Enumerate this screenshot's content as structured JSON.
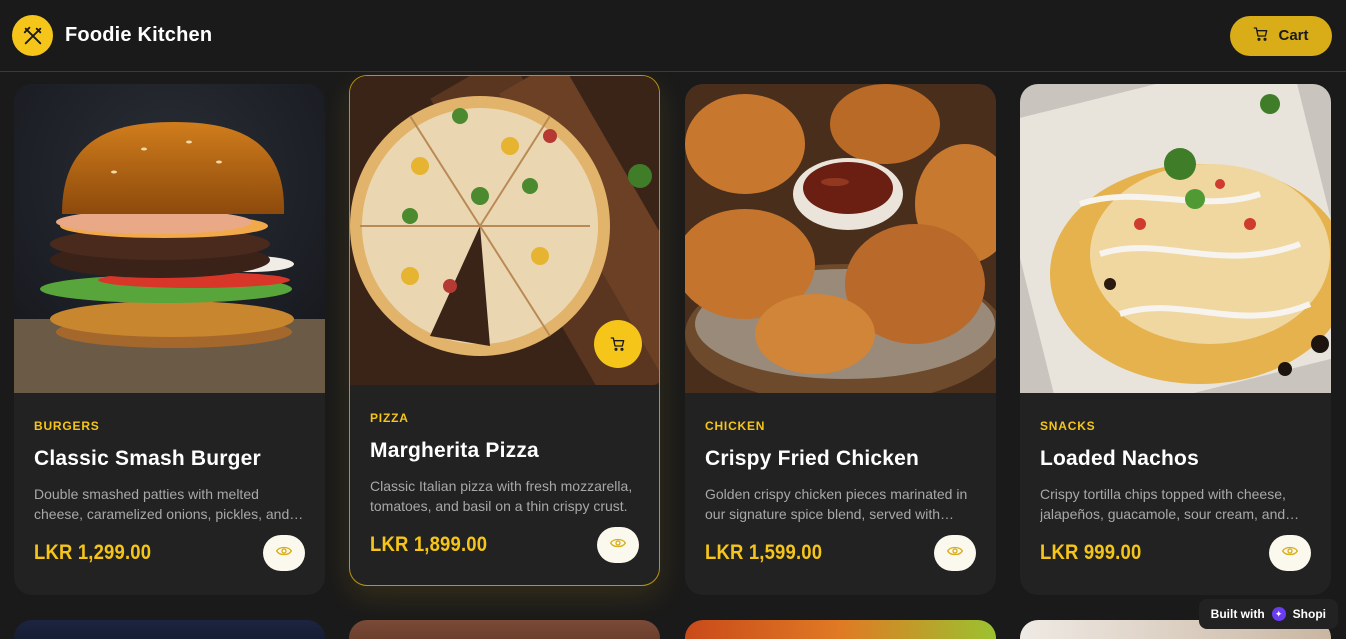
{
  "header": {
    "brand": "Foodie Kitchen",
    "logo_icon": "utensils-icon",
    "cart_label": "Cart",
    "cart_icon": "cart-icon"
  },
  "accent_color": "#f5c51a",
  "products": [
    {
      "category": "BURGERS",
      "name": "Classic Smash Burger",
      "description": "Double smashed patties with melted cheese, caramelized onions, pickles, and our special sauce on a toasted brioche bun.",
      "price": "LKR 1,299.00",
      "image": "burger-photo"
    },
    {
      "category": "PIZZA",
      "name": "Margherita Pizza",
      "description": "Classic Italian pizza with fresh mozzarella, tomatoes, and basil on a thin crispy crust.",
      "price": "LKR 1,899.00",
      "image": "pizza-photo",
      "hovered": true
    },
    {
      "category": "CHICKEN",
      "name": "Crispy Fried Chicken",
      "description": "Golden crispy chicken pieces marinated in our signature spice blend, served with dipping sauce.",
      "price": "LKR 1,599.00",
      "image": "fried-chicken-photo"
    },
    {
      "category": "SNACKS",
      "name": "Loaded Nachos",
      "description": "Crispy tortilla chips topped with cheese, jalapeños, guacamole, sour cream, and pico de gallo.",
      "price": "LKR 999.00",
      "image": "nachos-photo"
    }
  ],
  "badge": {
    "prefix": "Built with",
    "brand": "Shopi"
  }
}
